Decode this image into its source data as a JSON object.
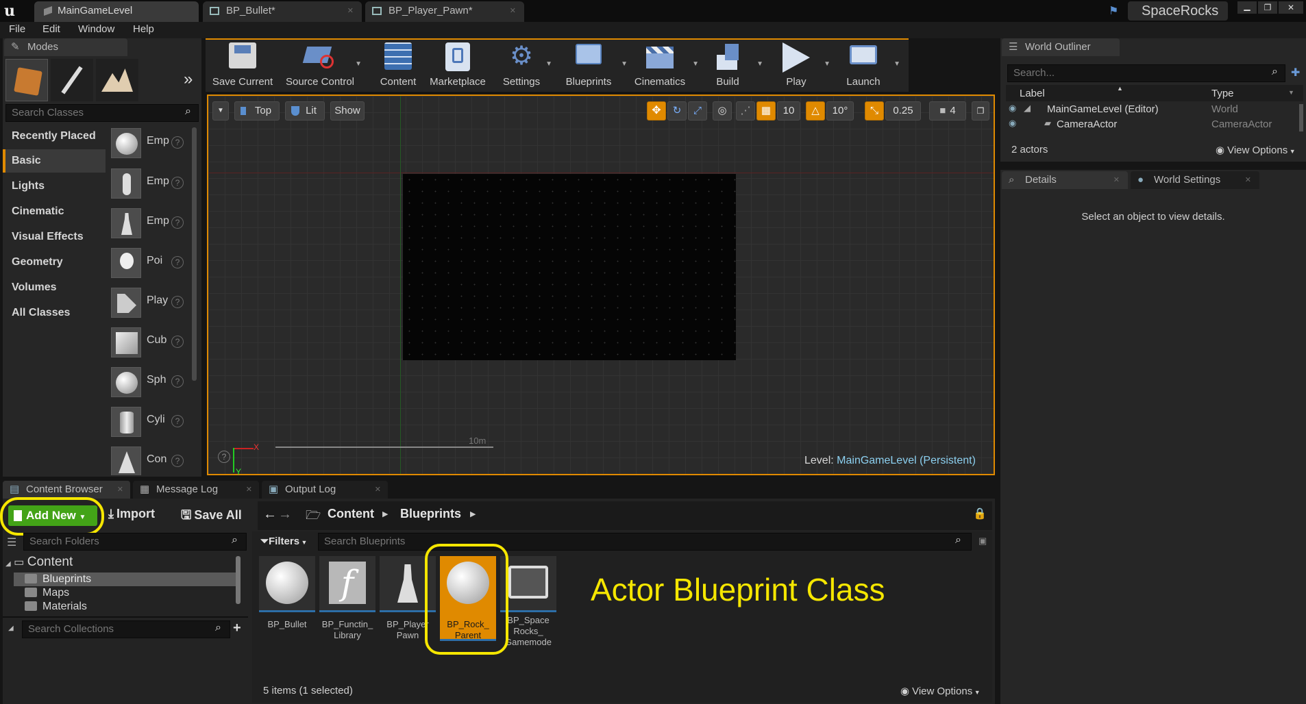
{
  "title_bar": {
    "tabs": [
      "MainGameLevel",
      "BP_Bullet*",
      "BP_Player_Pawn*"
    ],
    "project_name": "SpaceRocks"
  },
  "menu": [
    "File",
    "Edit",
    "Window",
    "Help"
  ],
  "modes": {
    "tab_label": "Modes",
    "search_placeholder": "Search Classes",
    "categories": [
      "Recently Placed",
      "Basic",
      "Lights",
      "Cinematic",
      "Visual Effects",
      "Geometry",
      "Volumes",
      "All Classes"
    ],
    "selected_category": "Basic",
    "items": [
      "Emp",
      "Emp",
      "Emp",
      "Poi",
      "Play",
      "Cub",
      "Sph",
      "Cyli",
      "Con"
    ],
    "help_glyph": "?"
  },
  "toolbar": {
    "buttons": [
      "Save Current",
      "Source Control",
      "Content",
      "Marketplace",
      "Settings",
      "Blueprints",
      "Cinematics",
      "Build",
      "Play",
      "Launch"
    ]
  },
  "viewport": {
    "view_mode": "Top",
    "lighting": "Lit",
    "show": "Show",
    "grid_snap": "10",
    "rotation_snap": "10°",
    "scale_snap": "0.25",
    "camera_speed": "4",
    "scale_label": "10m",
    "axis_x": "X",
    "axis_y": "Y",
    "level_prefix": "Level:",
    "level_name": "MainGameLevel (Persistent)"
  },
  "world_outliner": {
    "tab_label": "World Outliner",
    "search_placeholder": "Search...",
    "col_label": "Label",
    "col_type": "Type",
    "rows": [
      {
        "label": "MainGameLevel (Editor)",
        "type": "World"
      },
      {
        "label": "CameraActor",
        "type": "CameraActor"
      }
    ],
    "actor_count": "2 actors",
    "view_options": "View Options"
  },
  "details": {
    "tab_details": "Details",
    "tab_world_settings": "World Settings",
    "empty_message": "Select an object to view details."
  },
  "bottom_tabs": [
    "Content Browser",
    "Message Log",
    "Output Log"
  ],
  "content_browser": {
    "add_new": "Add New",
    "import": "Import",
    "save_all": "Save All",
    "breadcrumb": [
      "Content",
      "Blueprints"
    ],
    "search_folders_placeholder": "Search Folders",
    "filters": "Filters",
    "search_blueprints_placeholder": "Search Blueprints",
    "folders": {
      "root": "Content",
      "children": [
        "Blueprints",
        "Maps",
        "Materials"
      ]
    },
    "search_collections_placeholder": "Search Collections",
    "assets": [
      {
        "name": "BP_Bullet"
      },
      {
        "name": "BP_Functin_ Library"
      },
      {
        "name": "BP_Player Pawn"
      },
      {
        "name": "BP_Rock_ Parent"
      },
      {
        "name": "BP_Space Rocks_ Gamemode"
      }
    ],
    "selected_asset": "BP_Rock_ Parent",
    "status": "5 items (1 selected)",
    "view_options": "View Options"
  },
  "annotation": {
    "text": "Actor Blueprint Class",
    "color": "#f5e600"
  },
  "colors": {
    "accent_orange": "#e08a00",
    "add_new_green": "#43a317",
    "selection_yellow": "#f5e600"
  }
}
